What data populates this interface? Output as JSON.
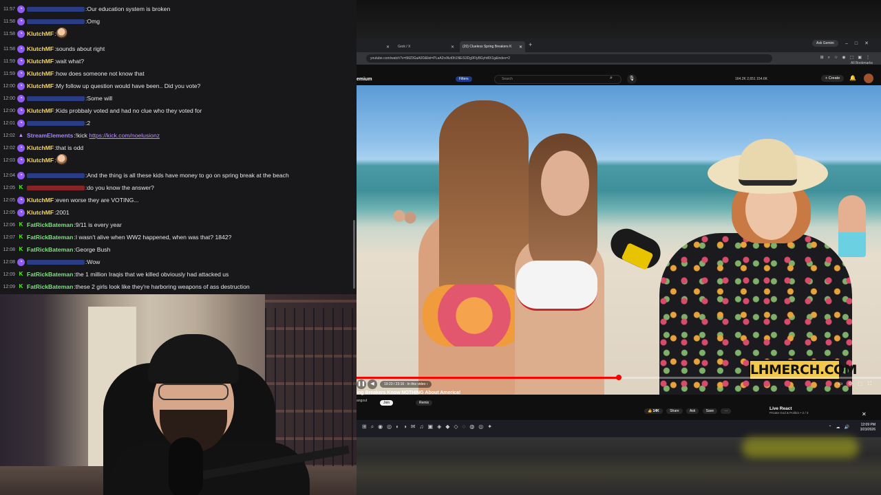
{
  "chat": {
    "messages": [
      {
        "time": "11:57",
        "badge": "sub",
        "user": "",
        "user_color": "#3b5bdb",
        "text": "Our education system is broken"
      },
      {
        "time": "11:58",
        "badge": "sub",
        "user": "",
        "user_color": "#3b5bdb",
        "text": "Omg"
      },
      {
        "time": "11:58",
        "badge": "sub",
        "user": "KlutchMF",
        "user_color": "#f5d76e",
        "text": "",
        "emote": true
      },
      {
        "time": "11:58",
        "badge": "sub",
        "user": "KlutchMF",
        "user_color": "#f5d76e",
        "text": "sounds about right"
      },
      {
        "time": "11:59",
        "badge": "sub",
        "user": "KlutchMF",
        "user_color": "#f5d76e",
        "text": "wait what?"
      },
      {
        "time": "11:59",
        "badge": "sub",
        "user": "KlutchMF",
        "user_color": "#f5d76e",
        "text": "how does someone not know that"
      },
      {
        "time": "12:00",
        "badge": "sub",
        "user": "KlutchMF",
        "user_color": "#f5d76e",
        "text": "My follow up question would have been.. Did you vote?"
      },
      {
        "time": "12:00",
        "badge": "sub",
        "user": "",
        "user_color": "#3b5bdb",
        "text": "Some will"
      },
      {
        "time": "12:00",
        "badge": "sub",
        "user": "KlutchMF",
        "user_color": "#f5d76e",
        "text": "Kids probbaly voted and had no clue who they voted for"
      },
      {
        "time": "12:01",
        "badge": "sub",
        "user": "",
        "user_color": "#3b5bdb",
        "text": "2"
      },
      {
        "time": "12:02",
        "badge": "bot",
        "user": "StreamElements",
        "user_color": "#a782ff",
        "text": "!kick ",
        "link": "https://kick.com/noelusionz"
      },
      {
        "time": "12:02",
        "badge": "sub",
        "user": "KlutchMF",
        "user_color": "#f5d76e",
        "text": "that is odd"
      },
      {
        "time": "12:03",
        "badge": "sub",
        "user": "KlutchMF",
        "user_color": "#f5d76e",
        "text": "",
        "emote": true
      },
      {
        "time": "12:04",
        "badge": "sub",
        "user": "",
        "user_color": "#3b5bdb",
        "text": "And the thing is all these kids have money to go on spring break at the beach"
      },
      {
        "time": "12:05",
        "badge": "kick",
        "user": "",
        "user_color": "#e03131",
        "text": "do you know the answer?"
      },
      {
        "time": "12:05",
        "badge": "sub",
        "user": "KlutchMF",
        "user_color": "#f5d76e",
        "text": "even worse they are VOTING..."
      },
      {
        "time": "12:05",
        "badge": "sub",
        "user": "KlutchMF",
        "user_color": "#f5d76e",
        "text": "2001"
      },
      {
        "time": "12:06",
        "badge": "kick",
        "user": "FatRickBateman",
        "user_color": "#7ee081",
        "text": "9/11 is every year"
      },
      {
        "time": "12:07",
        "badge": "kick",
        "user": "FatRickBateman",
        "user_color": "#7ee081",
        "text": "I wasn't alive when WW2 happened, when was that? 1842?"
      },
      {
        "time": "12:08",
        "badge": "kick",
        "user": "FatRickBateman",
        "user_color": "#7ee081",
        "text": "George Bush"
      },
      {
        "time": "12:08",
        "badge": "sub",
        "user": "",
        "user_color": "#3b5bdb",
        "text": "Wow"
      },
      {
        "time": "12:09",
        "badge": "kick",
        "user": "FatRickBateman",
        "user_color": "#7ee081",
        "text": "the 1 million Iraqis that we killed obviously had attacked us"
      },
      {
        "time": "12:09",
        "badge": "kick",
        "user": "FatRickBateman",
        "user_color": "#7ee081",
        "text": "these 2 girls look like they're harboring weapons of ass destruction"
      }
    ]
  },
  "browser": {
    "tabs": [
      {
        "label": "",
        "active": false
      },
      {
        "label": "Grok / X",
        "active": false
      },
      {
        "label": "(20) Clueless Spring Breakers K",
        "active": true
      }
    ],
    "ask_gemini": "Ask Gemini",
    "url": "youtube.com/watch?v=tMZ0GaA0D&list=PLaA2rsNvt0h1NEiS3Dg9FlyBGyht8X1g&index=2",
    "bookmarks": "All Bookmarks"
  },
  "youtube": {
    "logo": "emium",
    "filters": "Filters",
    "search_placeholder": "Search",
    "stats": "164.2K   2,651   154.6K",
    "create": "+ Create",
    "video_title": "ing Breakers Know NOTHING About America!",
    "channel": "angout",
    "join": "Join",
    "remix": "Remix",
    "time": "19:23 / 23:16",
    "in_this_video": "In this video",
    "progress": 0.5,
    "actions": [
      "14K",
      "Share",
      "Ask",
      "Save"
    ],
    "merch_overlay": "LHMERCH.COM",
    "live_react": {
      "title": "Live React",
      "subtitle": "Private God & Politics • 2 / 3"
    }
  },
  "taskbar": {
    "time": "12:09 PM",
    "date": "3/23/2026"
  },
  "colors": {
    "chat_bg": "#18181b",
    "link": "#bf94ff",
    "kick_green": "#53fc18",
    "sub_badge": "#8f5bf5",
    "yt_red": "#ff0000",
    "merch_yellow": "#f2c94c"
  }
}
